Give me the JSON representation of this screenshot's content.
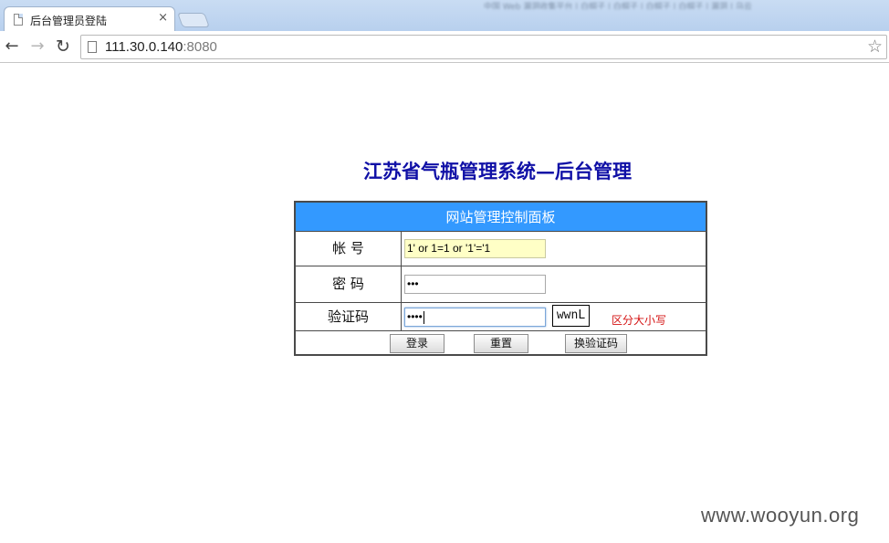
{
  "browser": {
    "tab_title": "后台管理员登陆",
    "tab_close": "×",
    "url_host": "111.30.0.140",
    "url_port": ":8080",
    "blurred_text": "中国 Web 漏洞收集平台 | 白帽子 | 白帽子 | 白帽子 | 白帽子 | 漏洞 | 乌云"
  },
  "page": {
    "title": "江苏省气瓶管理系统—后台管理"
  },
  "panel": {
    "header": "网站管理控制面板",
    "account_label": "帐 号",
    "account_value": "1' or 1=1 or '1'='1",
    "password_label": "密 码",
    "password_value": "•••",
    "captcha_label": "验证码",
    "captcha_value": "••••",
    "captcha_image_text": "wwnL",
    "case_note": "区分大小写",
    "login_button": "登录",
    "reset_button": "重置",
    "change_captcha_button": "换验证码"
  },
  "watermark": "www.wooyun.org",
  "colors": {
    "header_bg": "#3399ff",
    "title_color": "#1010a6",
    "note_color": "#d41111"
  }
}
